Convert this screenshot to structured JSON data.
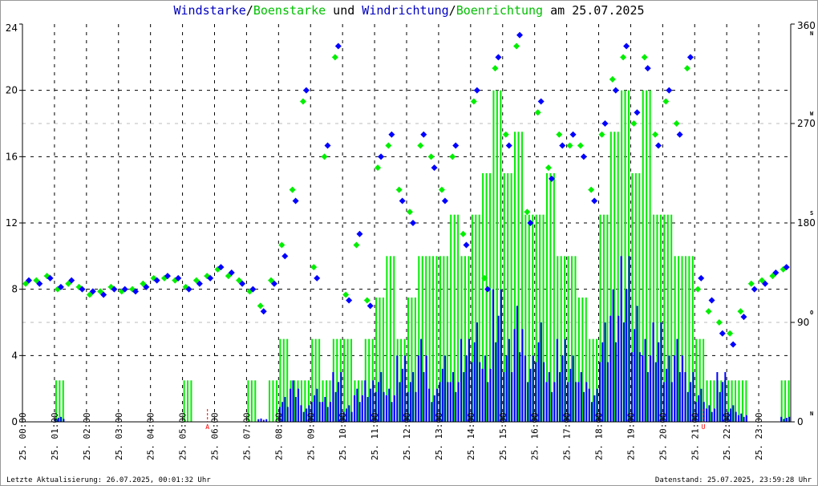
{
  "chart_data": {
    "type": "bar+scatter",
    "title_parts": {
      "a": "Windstarke",
      "sep1": "/",
      "b": "Boenstarke",
      "mid": " und ",
      "c": "Windrichtung",
      "sep2": "/",
      "d": "Boenrichtung",
      "end": " am 25.07.2025"
    },
    "ylim_left": [
      0,
      24
    ],
    "yticks_left": [
      "0",
      "4",
      "8",
      "12",
      "16",
      "20",
      "24"
    ],
    "ylim_right": [
      0,
      360
    ],
    "yticks_right": [
      {
        "v": "0",
        "d": "N"
      },
      {
        "v": "90",
        "d": "O"
      },
      {
        "v": "180",
        "d": "S"
      },
      {
        "v": "270",
        "d": "W"
      },
      {
        "v": "360",
        "d": "N"
      }
    ],
    "xticks": [
      "25. 00:00",
      "25. 01:00",
      "25. 02:00",
      "25. 03:00",
      "25. 04:00",
      "25. 05:00",
      "25. 06:00",
      "25. 07:00",
      "25. 08:00",
      "25. 09:00",
      "25. 10:00",
      "25. 11:00",
      "25. 12:00",
      "25. 13:00",
      "25. 14:00",
      "25. 15:00",
      "25. 16:00",
      "25. 17:00",
      "25. 18:00",
      "25. 19:00",
      "25. 20:00",
      "25. 21:00",
      "25. 22:00",
      "25. 23:00"
    ],
    "markers": [
      {
        "label": "A",
        "hour": 5.78
      },
      {
        "label": "U",
        "hour": 21.27
      }
    ],
    "interval_minutes": 20,
    "colors": {
      "speed": "#0000ff",
      "gust": "#00ee00",
      "marker": "#ff0000"
    },
    "speed": [
      0,
      0,
      0,
      0.3,
      0,
      0,
      0,
      0,
      0,
      0,
      0,
      0,
      0,
      0,
      0,
      0,
      0,
      0,
      0,
      0,
      0,
      0,
      0.2,
      0,
      1.5,
      2.5,
      1,
      2,
      1.5,
      3,
      1,
      2,
      2.5,
      3,
      2,
      4,
      3,
      5,
      2,
      4,
      3,
      5,
      6,
      4,
      8,
      5,
      7,
      4,
      6,
      3,
      5,
      4,
      3,
      2,
      6,
      8,
      10,
      7,
      5,
      6,
      4,
      5,
      3,
      2,
      1,
      3,
      1,
      0.5,
      0,
      0,
      0,
      0.3
    ],
    "gust": [
      0,
      0,
      0,
      2.5,
      0,
      0,
      0,
      0,
      0,
      0,
      0,
      0,
      0,
      0,
      0,
      2.5,
      0,
      0,
      0,
      0,
      0,
      2.5,
      0,
      2.5,
      5,
      2.5,
      2.5,
      5,
      2.5,
      5,
      5,
      2.5,
      5,
      7.5,
      10,
      5,
      7.5,
      10,
      10,
      10,
      12.5,
      10,
      12.5,
      15,
      20,
      15,
      17.5,
      12.5,
      12.5,
      15,
      10,
      10,
      7.5,
      5,
      12.5,
      17.5,
      20,
      15,
      20,
      12.5,
      12.5,
      10,
      10,
      5,
      2.5,
      2.5,
      2.5,
      2.5,
      0,
      0,
      0,
      2.5
    ],
    "direction": [
      128,
      125,
      130,
      122,
      128,
      120,
      118,
      115,
      120,
      120,
      118,
      122,
      128,
      132,
      130,
      120,
      125,
      130,
      140,
      135,
      125,
      120,
      100,
      125,
      150,
      200,
      300,
      130,
      250,
      340,
      110,
      170,
      105,
      240,
      260,
      200,
      180,
      260,
      230,
      200,
      250,
      160,
      300,
      120,
      330,
      250,
      350,
      180,
      290,
      220,
      250,
      260,
      240,
      200,
      270,
      300,
      340,
      280,
      320,
      250,
      300,
      260,
      330,
      130,
      110,
      80,
      70,
      95,
      120,
      125,
      135,
      140
    ],
    "gust_direction": [
      125,
      128,
      132,
      120,
      125,
      122,
      115,
      118,
      122,
      118,
      120,
      125,
      130,
      130,
      128,
      122,
      128,
      132,
      138,
      132,
      128,
      118,
      105,
      128,
      160,
      210,
      290,
      140,
      240,
      330,
      115,
      160,
      110,
      230,
      250,
      210,
      190,
      250,
      240,
      210,
      240,
      170,
      290,
      130,
      320,
      260,
      340,
      190,
      280,
      230,
      260,
      250,
      250,
      210,
      260,
      310,
      330,
      270,
      330,
      260,
      290,
      270,
      320,
      120,
      100,
      90,
      80,
      100,
      125,
      128,
      132,
      138
    ]
  },
  "footer": {
    "left": "Letzte Aktualisierung: 26.07.2025, 00:01:32 Uhr",
    "right": "Datenstand: 25.07.2025, 23:59:28 Uhr"
  }
}
